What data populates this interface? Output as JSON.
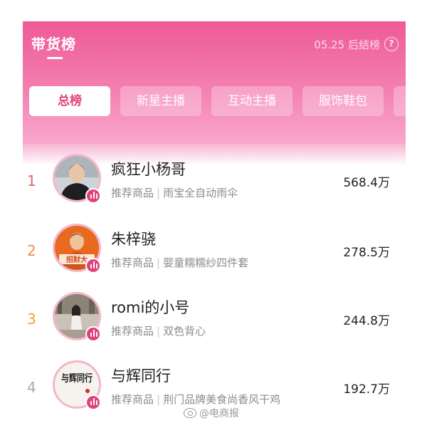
{
  "header": {
    "title": "带货榜",
    "update_text": "05.25 后结榜",
    "help_glyph": "?"
  },
  "tabs": [
    {
      "label": "总榜",
      "active": true
    },
    {
      "label": "新星主播",
      "active": false
    },
    {
      "label": "互动主播",
      "active": false
    },
    {
      "label": "服饰鞋包",
      "active": false
    }
  ],
  "ranking": [
    {
      "rank": "1",
      "rank_color": "#e9636b",
      "name": "疯狂小杨哥",
      "prefix": "推荐商品",
      "product": "雨宝全自动雨伞",
      "amount": "568.4万"
    },
    {
      "rank": "2",
      "rank_color": "#ef8c4a",
      "name": "朱梓骁",
      "prefix": "推荐商品",
      "product": "婴童糯糯纱四件套",
      "amount": "278.5万"
    },
    {
      "rank": "3",
      "rank_color": "#efa43a",
      "name": "romi的小号",
      "prefix": "推荐商品",
      "product": "双色背心",
      "amount": "244.8万"
    },
    {
      "rank": "4",
      "rank_color": "#a9a9a9",
      "name": "与辉同行",
      "prefix": "推荐商品",
      "product": "荆门品牌美食尚香风干鸡",
      "amount": "192.7万"
    }
  ],
  "avatar_texts": {
    "row2_logo": "招财大",
    "row4_logo": "与辉同行"
  },
  "watermark": "@电商报",
  "colors": {
    "header_top": "#ee5a96",
    "header_bottom": "#f8a8cc",
    "active_tab_text": "#e3427c",
    "live_badge": "#e0427c"
  }
}
